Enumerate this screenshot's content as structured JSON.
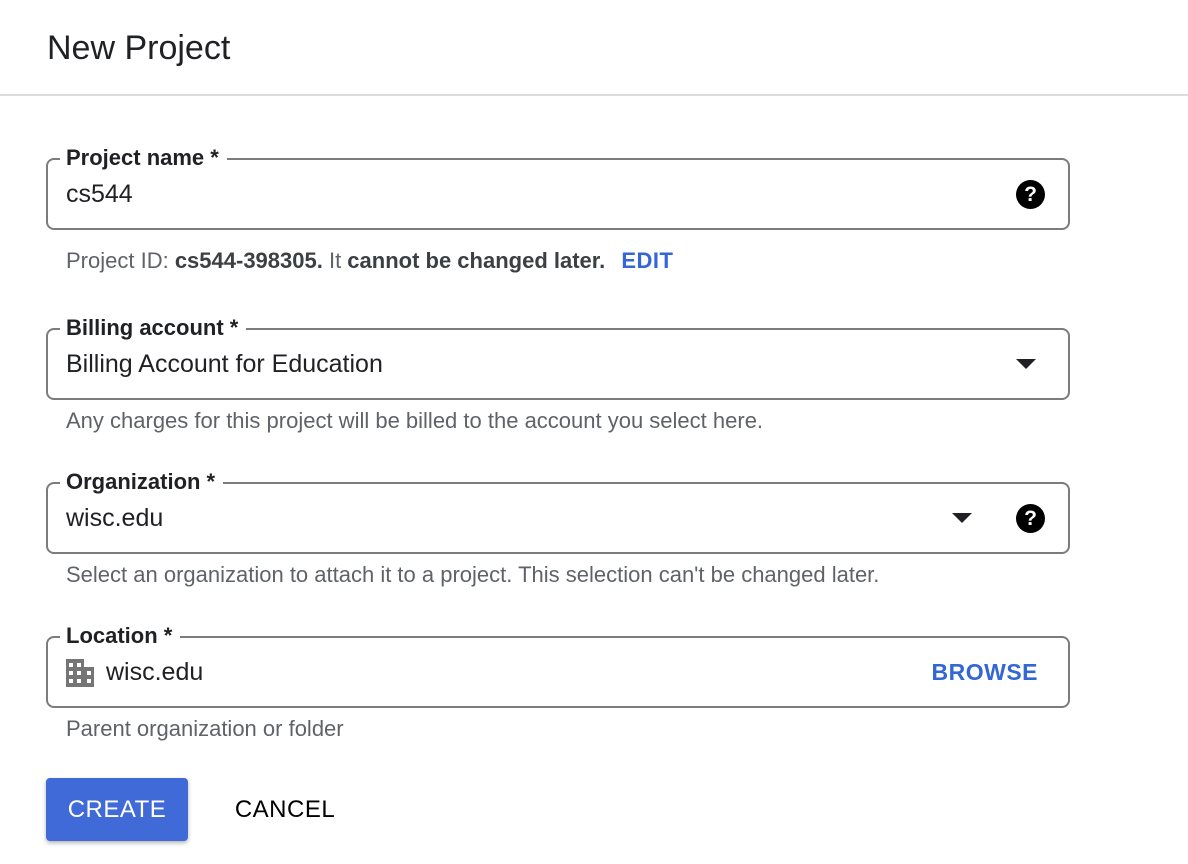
{
  "header": {
    "title": "New Project"
  },
  "project_name": {
    "label": "Project name *",
    "value": "cs544",
    "help_icon": "help-circle-icon"
  },
  "project_id_hint": {
    "prefix": "Project ID: ",
    "id": "cs544-398305.",
    "middle": " It ",
    "note": "cannot be changed later.",
    "edit_label": "EDIT"
  },
  "billing_account": {
    "label": "Billing account *",
    "value": "Billing Account for Education",
    "hint": "Any charges for this project will be billed to the account you select here.",
    "dropdown_icon": "arrow-drop-down-icon"
  },
  "organization": {
    "label": "Organization *",
    "value": "wisc.edu",
    "hint": "Select an organization to attach it to a project. This selection can't be changed later.",
    "dropdown_icon": "arrow-drop-down-icon",
    "help_icon": "help-circle-icon"
  },
  "location": {
    "label": "Location *",
    "value": "wisc.edu",
    "icon": "domain-building-icon",
    "browse_label": "BROWSE",
    "hint": "Parent organization or folder"
  },
  "actions": {
    "create_label": "CREATE",
    "cancel_label": "CANCEL"
  },
  "colors": {
    "primary": "#3f6ad8",
    "link": "#3367d6",
    "border": "#7c7c7c",
    "hint_text": "#5f6368"
  }
}
